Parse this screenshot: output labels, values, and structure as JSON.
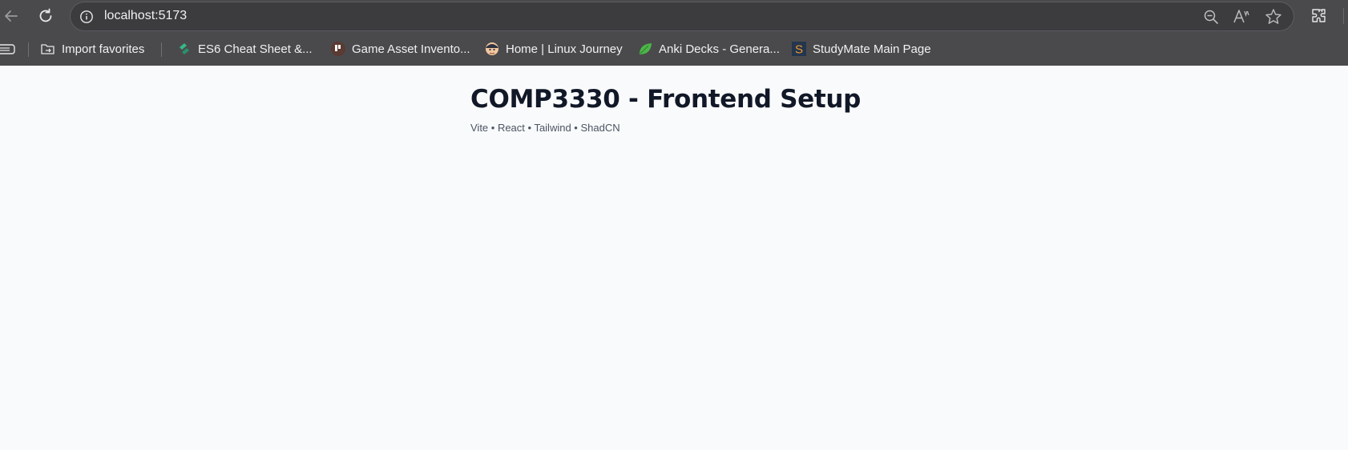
{
  "browser": {
    "url": "localhost:5173",
    "bookmarks": [
      {
        "label": "Import favorites",
        "icon": "import-favorites-icon"
      },
      {
        "label": "ES6 Cheat Sheet &...",
        "icon": "es6-site-icon"
      },
      {
        "label": "Game Asset Invento...",
        "icon": "game-asset-site-icon"
      },
      {
        "label": "Home | Linux Journey",
        "icon": "linux-journey-site-icon"
      },
      {
        "label": "Anki Decks - Genera...",
        "icon": "anki-leaf-icon"
      },
      {
        "label": "StudyMate Main Page",
        "icon": "studymate-s-icon"
      }
    ]
  },
  "page": {
    "title": "COMP3330 - Frontend Setup",
    "subtitle": "Vite • React • Tailwind • ShadCN"
  },
  "colors": {
    "chrome_background": "#4a4a4d",
    "page_background": "#f9fafb",
    "title_color": "#111827",
    "subtitle_color": "#4b5563"
  }
}
